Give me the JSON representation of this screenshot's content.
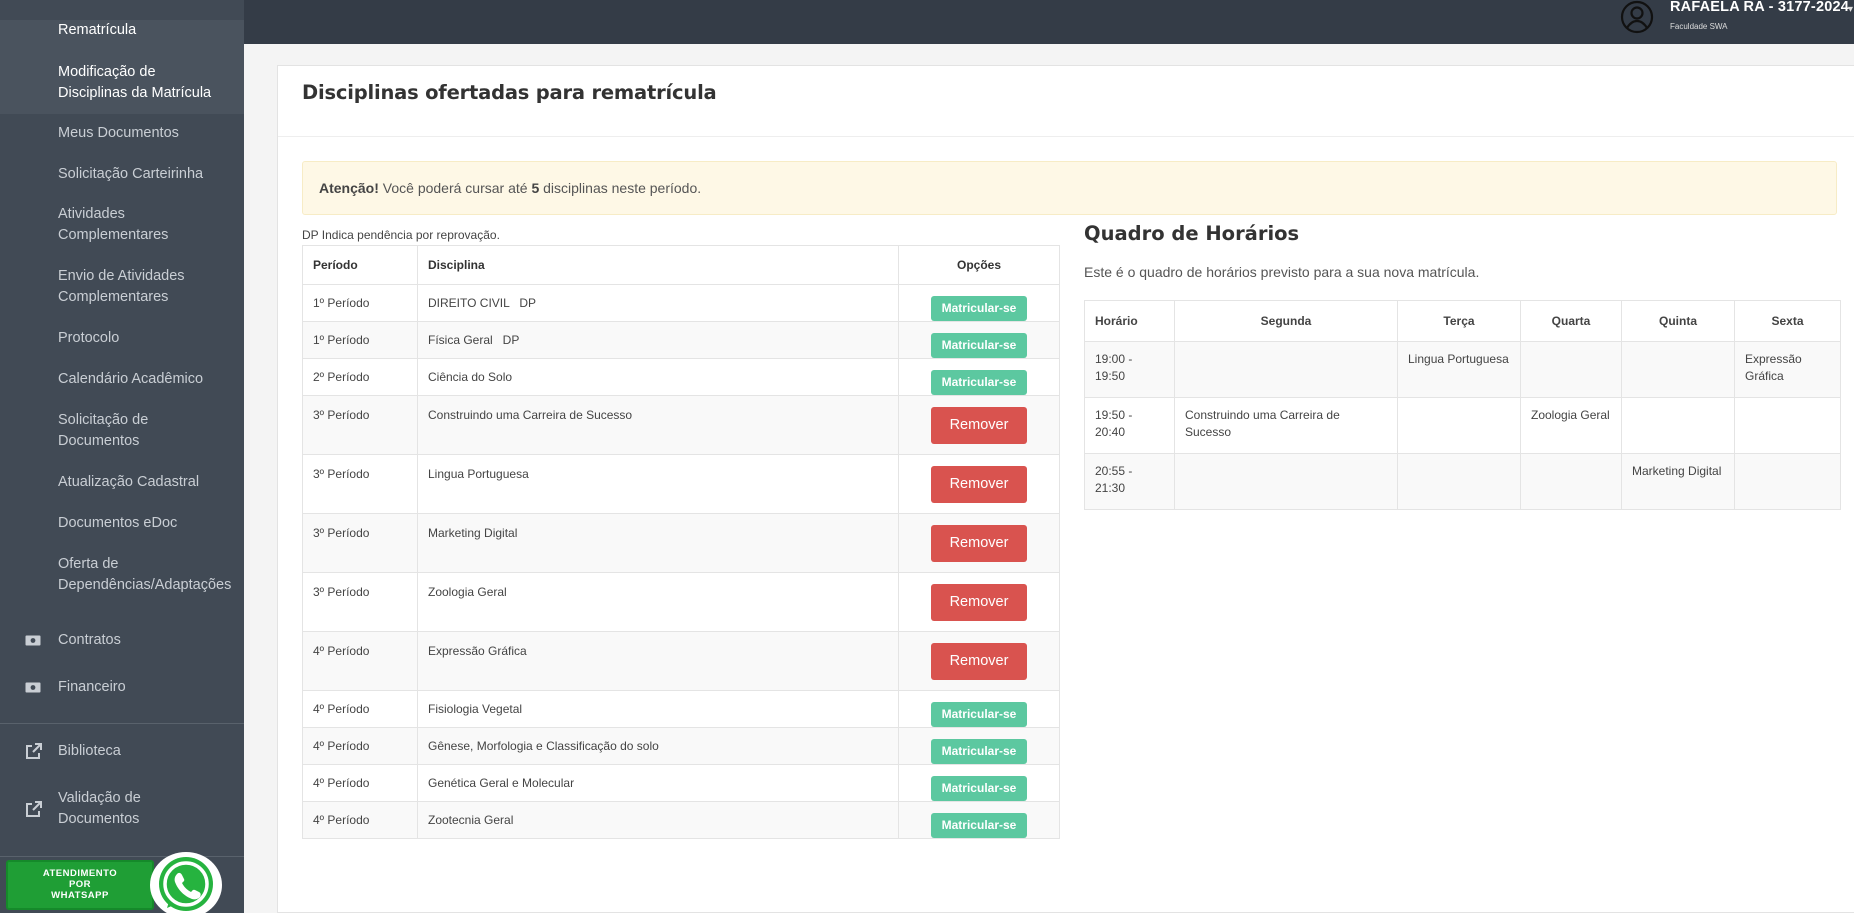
{
  "sidebar": {
    "items": [
      {
        "label": "Rematrícula"
      },
      {
        "label": "Modificação de Disciplinas da Matrícula"
      },
      {
        "label": "Meus Documentos"
      },
      {
        "label": "Solicitação Carteirinha"
      },
      {
        "label": "Atividades Complementares"
      },
      {
        "label": "Envio de Atividades Complementares"
      },
      {
        "label": "Protocolo"
      },
      {
        "label": "Calendário Acadêmico"
      },
      {
        "label": "Solicitação de Documentos"
      },
      {
        "label": "Atualização Cadastral"
      },
      {
        "label": "Documentos eDoc"
      },
      {
        "label": "Oferta de Dependências/Adaptações"
      },
      {
        "label": "Contratos",
        "icon": "money-icon"
      },
      {
        "label": "Financeiro",
        "icon": "money-icon"
      },
      {
        "label": "Biblioteca",
        "icon": "external-link-icon"
      },
      {
        "label": "Validação de Documentos",
        "icon": "external-link-icon"
      }
    ],
    "whatsapp": {
      "line1": "ATENDIMENTO",
      "line2": "POR",
      "line3": "WHATSAPP"
    }
  },
  "header": {
    "user_name": "RAFAELA RA - 3177-2024",
    "organization": "Faculdade SWA"
  },
  "main": {
    "title": "Disciplinas ofertadas para rematrícula",
    "alert_strong": "Atenção!",
    "alert_text_before": " Você poderá cursar até ",
    "alert_count": "5",
    "alert_text_after": " disciplinas neste período.",
    "dp_note": "DP Indica pendência por reprovação.",
    "table_headers": {
      "period": "Período",
      "discipline": "Disciplina",
      "options": "Opções"
    },
    "rows": [
      {
        "period": "1º Período",
        "discipline": "DIREITO CIVIL   DP",
        "action": "Matricular-se"
      },
      {
        "period": "1º Período",
        "discipline": "Física Geral   DP",
        "action": "Matricular-se"
      },
      {
        "period": "2º Período",
        "discipline": "Ciência do Solo",
        "action": "Matricular-se"
      },
      {
        "period": "3º Período",
        "discipline": "Construindo uma Carreira de Sucesso",
        "action": "Remover"
      },
      {
        "period": "3º Período",
        "discipline": "Lingua Portuguesa",
        "action": "Remover"
      },
      {
        "period": "3º Período",
        "discipline": "Marketing Digital",
        "action": "Remover"
      },
      {
        "period": "3º Período",
        "discipline": "Zoologia Geral",
        "action": "Remover"
      },
      {
        "period": "4º Período",
        "discipline": "Expressão Gráfica",
        "action": "Remover"
      },
      {
        "period": "4º Período",
        "discipline": "Fisiologia Vegetal",
        "action": "Matricular-se"
      },
      {
        "period": "4º Período",
        "discipline": "Gênese, Morfologia e Classificação do solo",
        "action": "Matricular-se"
      },
      {
        "period": "4º Período",
        "discipline": "Genética Geral e Molecular",
        "action": "Matricular-se"
      },
      {
        "period": "4º Período",
        "discipline": "Zootecnia Geral",
        "action": "Matricular-se"
      }
    ]
  },
  "schedule": {
    "title": "Quadro de Horários",
    "subtitle": "Este é o quadro de horários previsto para a sua nova matrícula.",
    "headers": [
      "Horário",
      "Segunda",
      "Terça",
      "Quarta",
      "Quinta",
      "Sexta"
    ],
    "rows": [
      [
        "19:00 - 19:50",
        "",
        "Lingua Portuguesa",
        "",
        "",
        "Expressão Gráfica"
      ],
      [
        "19:50 - 20:40",
        "Construindo uma Carreira de Sucesso",
        "",
        "Zoologia Geral",
        "",
        ""
      ],
      [
        "20:55 - 21:30",
        "",
        "",
        "",
        "Marketing Digital",
        ""
      ]
    ]
  },
  "colors": {
    "sidebar_bg": "#414a55",
    "topbar_bg": "#343c47",
    "enroll_button": "#5cc8a0",
    "remove_button": "#d9534f",
    "alert_bg": "#fef8e6"
  }
}
